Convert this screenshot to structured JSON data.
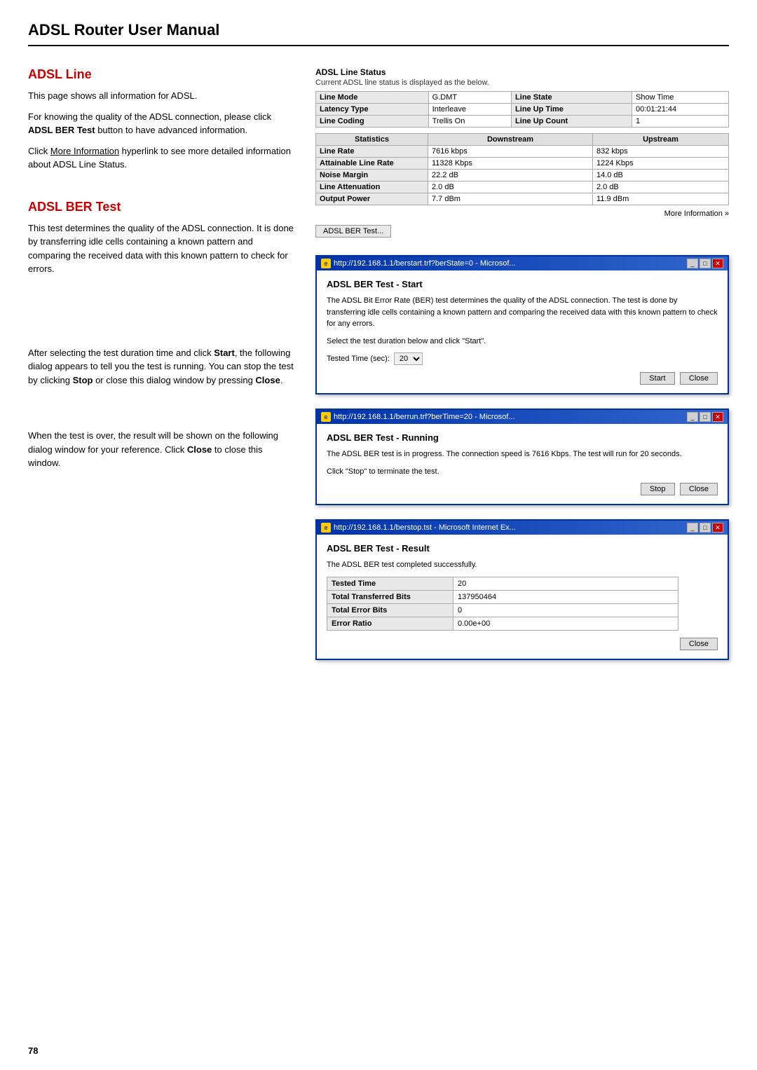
{
  "page": {
    "header_title": "ADSL Router User Manual",
    "page_number": "78"
  },
  "adsl_line": {
    "section_title": "ADSL Line",
    "para1": "This page shows all information for ADSL.",
    "para2_prefix": "For knowing the quality of the ADSL connection, please click ",
    "para2_bold": "ADSL BER Test",
    "para2_suffix": " button to have advanced information.",
    "para3_prefix": "Click ",
    "para3_link": "More Information",
    "para3_suffix": " hyperlink to see more detailed information about ADSL Line Status."
  },
  "adsl_ber_test_section": {
    "section_title": "ADSL BER Test",
    "para1": "This test determines the quality of the ADSL connection. It is done by transferring idle cells containing a known pattern and comparing the received data with this known pattern to check for errors.",
    "para2_prefix": "After selecting the test duration time and click ",
    "para2_bold1": "Start",
    "para2_mid": ", the following dialog appears to tell you the test is running. You can stop the test by clicking ",
    "para2_bold2": "Stop",
    "para2_suffix": " or close this dialog window by pressing ",
    "para2_bold3": "Close",
    "para2_end": ".",
    "para3_prefix": "When the test is over, the result will be shown on the following dialog window for your reference. Click ",
    "para3_bold": "Close",
    "para3_suffix": " to close this window."
  },
  "line_status": {
    "title": "ADSL Line Status",
    "subtitle": "Current ADSL line status is displayed as the below.",
    "top_table": {
      "headers": [
        "Line Mode",
        "G.DMT",
        "Line State",
        "Show Time"
      ],
      "row2": [
        "Latency Type",
        "Interleave",
        "Line Up Time",
        "00:01:21:44"
      ],
      "row3": [
        "Line Coding",
        "Trellis On",
        "Line Up Count",
        "1"
      ]
    },
    "stats_table": {
      "headers": [
        "Statistics",
        "Downstream",
        "Upstream"
      ],
      "rows": [
        [
          "Line Rate",
          "7616 kbps",
          "832 kbps"
        ],
        [
          "Attainable Line Rate",
          "11328 Kbps",
          "1224 Kbps"
        ],
        [
          "Noise Margin",
          "22.2 dB",
          "14.0 dB"
        ],
        [
          "Line Attenuation",
          "2.0 dB",
          "2.0 dB"
        ],
        [
          "Output Power",
          "7.7 dBm",
          "11.9 dBm"
        ]
      ]
    },
    "more_info": "More Information »",
    "ber_btn": "ADSL BER Test..."
  },
  "dialog1": {
    "titlebar": "http://192.168.1.1/berstart.trf?berState=0 - Microsof...",
    "title": "ADSL BER Test - Start",
    "para": "The ADSL Bit Error Rate (BER) test determines the quality of the ADSL connection. The test is done by transferring idle cells containing a known pattern and comparing the received data with this known pattern to check for any errors.",
    "instruction": "Select the test duration below and click \"Start\".",
    "tested_time_label": "Tested Time (sec):",
    "tested_time_value": "20",
    "btn_start": "Start",
    "btn_close": "Close"
  },
  "dialog2": {
    "titlebar": "http://192.168.1.1/berrun.trf?berTime=20 - Microsof...",
    "title": "ADSL BER Test - Running",
    "para": "The ADSL BER test is in progress. The connection speed is 7616 Kbps. The test will run for 20 seconds.",
    "instruction": "Click \"Stop\" to terminate the test.",
    "btn_stop": "Stop",
    "btn_close": "Close"
  },
  "dialog3": {
    "titlebar": "http://192.168.1.1/berstop.tst - Microsoft Internet Ex...",
    "title": "ADSL BER Test - Result",
    "para": "The ADSL BER test completed successfully.",
    "result_rows": [
      [
        "Tested Time",
        "20"
      ],
      [
        "Total Transferred Bits",
        "137950464"
      ],
      [
        "Total Error Bits",
        "0"
      ],
      [
        "Error Ratio",
        "0.00e+00"
      ]
    ],
    "btn_close": "Close"
  }
}
